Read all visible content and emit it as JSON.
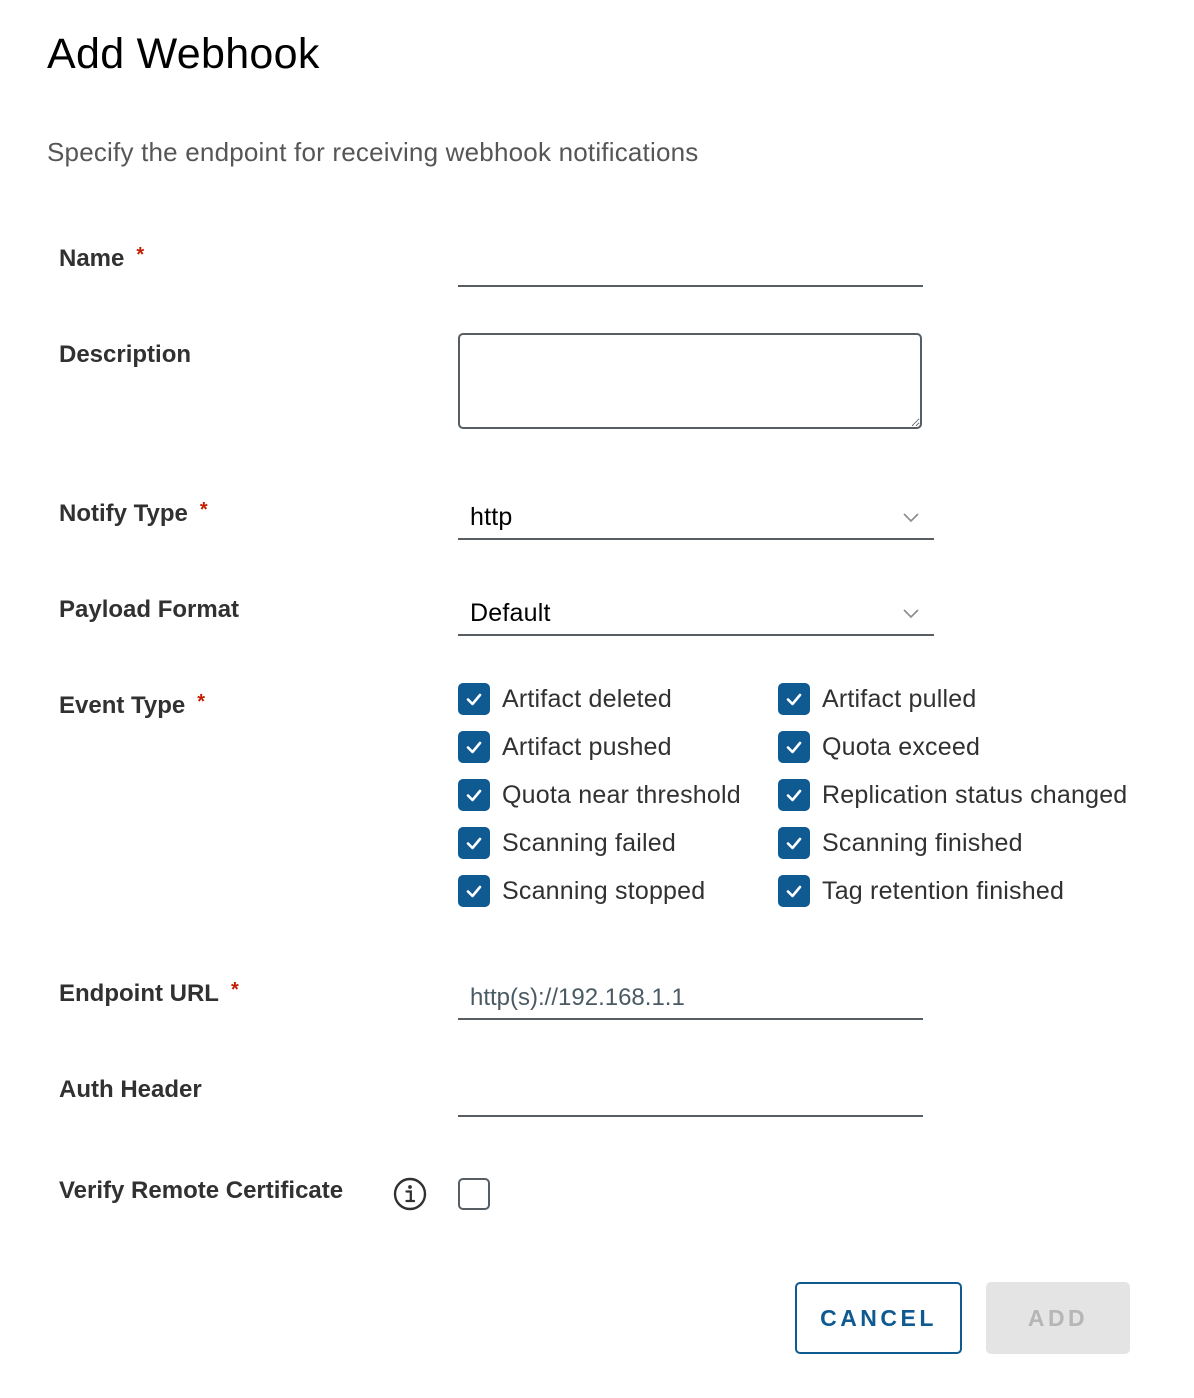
{
  "dialog": {
    "title": "Add Webhook",
    "subtitle": "Specify the endpoint for receiving webhook notifications"
  },
  "form": {
    "required_marker": "*",
    "name": {
      "label": "Name",
      "required": true,
      "value": "",
      "placeholder": ""
    },
    "description": {
      "label": "Description",
      "required": false,
      "value": ""
    },
    "notify_type": {
      "label": "Notify Type",
      "required": true,
      "selected": "http",
      "icon": "chevron-down-icon"
    },
    "payload_format": {
      "label": "Payload Format",
      "required": false,
      "selected": "Default",
      "icon": "chevron-down-icon"
    },
    "event_type": {
      "label": "Event Type",
      "required": true,
      "options": [
        {
          "label": "Artifact deleted",
          "checked": true
        },
        {
          "label": "Artifact pulled",
          "checked": true
        },
        {
          "label": "Artifact pushed",
          "checked": true
        },
        {
          "label": "Quota exceed",
          "checked": true
        },
        {
          "label": "Quota near threshold",
          "checked": true
        },
        {
          "label": "Replication status changed",
          "checked": true
        },
        {
          "label": "Scanning failed",
          "checked": true
        },
        {
          "label": "Scanning finished",
          "checked": true
        },
        {
          "label": "Scanning stopped",
          "checked": true
        },
        {
          "label": "Tag retention finished",
          "checked": true
        }
      ]
    },
    "endpoint_url": {
      "label": "Endpoint URL",
      "required": true,
      "value": "",
      "placeholder": "http(s)://192.168.1.1"
    },
    "auth_header": {
      "label": "Auth Header",
      "required": false,
      "value": "",
      "placeholder": ""
    },
    "verify_remote_certificate": {
      "label": "Verify Remote Certificate",
      "checked": false,
      "icon": "info-icon"
    }
  },
  "actions": {
    "cancel_label": "CANCEL",
    "add_label": "ADD",
    "add_disabled": true
  },
  "colors": {
    "primary": "#0f5b91",
    "required": "#c21d00",
    "disabled_bg": "#e4e4e4",
    "disabled_text": "#b6b6b6",
    "input_border": "#565e63"
  }
}
